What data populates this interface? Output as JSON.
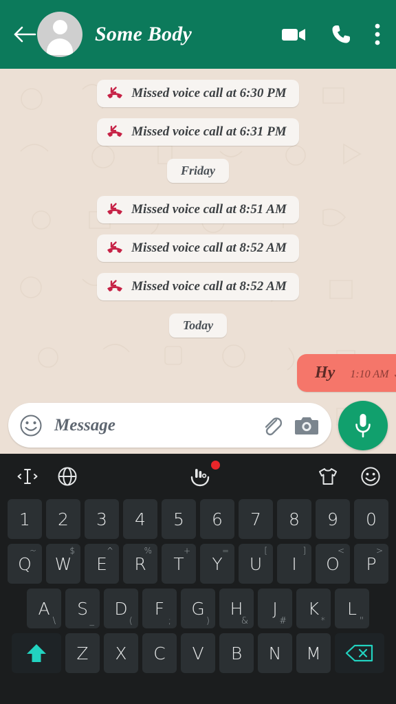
{
  "app": "WhatsApp chat",
  "colors": {
    "header_green": "#0C7A5B",
    "chat_background": "#ECE0D5",
    "outgoing_bubble": "#F5766A",
    "mic_green": "#11A06D",
    "missed_call_red": "#C62246",
    "keyboard_background": "#1B1D1E",
    "key_background": "#2B3033",
    "key_accent_teal": "#22D3C0",
    "badge_red": "#E8262A"
  },
  "header": {
    "back_icon": "back-arrow-icon",
    "avatar_icon": "default-avatar-icon",
    "contact_name": "Some Body",
    "video_call_icon": "video-call-icon",
    "voice_call_icon": "phone-call-icon",
    "menu_icon": "overflow-menu-icon"
  },
  "chat": {
    "items": [
      {
        "kind": "missed_call",
        "icon": "missed-call-icon",
        "text": "Missed voice call at 6:30 PM"
      },
      {
        "kind": "missed_call",
        "icon": "missed-call-icon",
        "text": "Missed voice call at 6:31 PM"
      },
      {
        "kind": "date_divider",
        "text": "Friday"
      },
      {
        "kind": "missed_call",
        "icon": "missed-call-icon",
        "text": "Missed voice call at 8:51 AM"
      },
      {
        "kind": "missed_call",
        "icon": "missed-call-icon",
        "text": "Missed voice call at 8:52 AM"
      },
      {
        "kind": "missed_call",
        "icon": "missed-call-icon",
        "text": "Missed voice call at 8:52 AM"
      },
      {
        "kind": "date_divider",
        "text": "Today"
      },
      {
        "kind": "outgoing_message",
        "text": "Hy",
        "time": "1:10 AM",
        "status_icon": "double-check-icon"
      }
    ]
  },
  "input_bar": {
    "emoji_icon": "emoji-smiley-icon",
    "placeholder": "Message",
    "attach_icon": "paperclip-icon",
    "camera_icon": "camera-icon",
    "mic_icon": "microphone-icon"
  },
  "keyboard": {
    "toolbar": {
      "cursor_control_icon": "text-cursor-icon",
      "language_icon": "globe-icon",
      "gesture_icon": "hand-gesture-icon",
      "gesture_badge": "notification-dot",
      "theme_icon": "t-shirt-theme-icon",
      "emoji_icon": "emoji-smiley-icon"
    },
    "rows": {
      "numbers": [
        "1",
        "2",
        "3",
        "4",
        "5",
        "6",
        "7",
        "8",
        "9",
        "0"
      ],
      "top": [
        {
          "key": "Q",
          "alt": "~"
        },
        {
          "key": "W",
          "alt": "$"
        },
        {
          "key": "E",
          "alt": "^"
        },
        {
          "key": "R",
          "alt": "%"
        },
        {
          "key": "T",
          "alt": "+"
        },
        {
          "key": "Y",
          "alt": "="
        },
        {
          "key": "U",
          "alt": "["
        },
        {
          "key": "I",
          "alt": "]"
        },
        {
          "key": "O",
          "alt": "<"
        },
        {
          "key": "P",
          "alt": ">"
        }
      ],
      "home": [
        {
          "key": "A",
          "alt": "\\"
        },
        {
          "key": "S",
          "alt": "_"
        },
        {
          "key": "D",
          "alt": "("
        },
        {
          "key": "F",
          "alt": ";"
        },
        {
          "key": "G",
          "alt": ")"
        },
        {
          "key": "H",
          "alt": "&"
        },
        {
          "key": "J",
          "alt": "#"
        },
        {
          "key": "K",
          "alt": "*"
        },
        {
          "key": "L",
          "alt": "\""
        }
      ],
      "bottom": [
        {
          "key": "Z",
          "alt": ""
        },
        {
          "key": "X",
          "alt": ""
        },
        {
          "key": "C",
          "alt": ""
        },
        {
          "key": "V",
          "alt": ""
        },
        {
          "key": "B",
          "alt": ""
        },
        {
          "key": "N",
          "alt": ""
        },
        {
          "key": "M",
          "alt": ""
        }
      ],
      "shift_icon": "shift-arrow-icon",
      "backspace_icon": "backspace-icon"
    }
  }
}
